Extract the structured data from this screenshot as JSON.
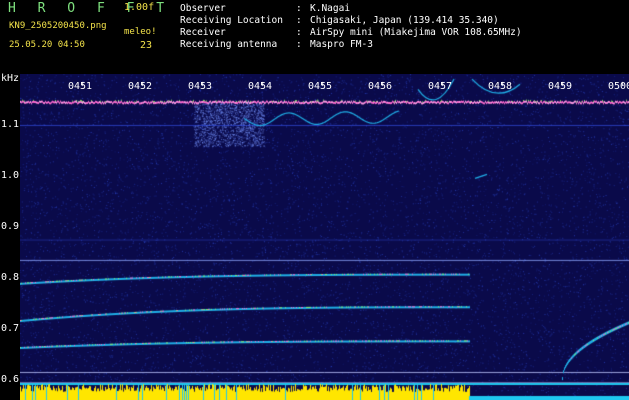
{
  "header": {
    "brand": "H R O F F T",
    "version": "1.00f",
    "filename": "KN9_2505200450.png",
    "datetime": "25.05.20 04:50",
    "counter_label": "meleo!",
    "counter_value": "23"
  },
  "info": [
    {
      "key": "Observer",
      "value": "K.Nagai"
    },
    {
      "key": "Receiving Location",
      "value": "Chigasaki, Japan (139.414 35.340)"
    },
    {
      "key": "Receiver",
      "value": "AirSpy mini (Miakejima VOR 108.65MHz)"
    },
    {
      "key": "Receiving antenna",
      "value": "Maspro FM-3"
    }
  ],
  "spectrogram": {
    "unit": "kHz",
    "time_ticks": [
      "0451",
      "0452",
      "0453",
      "0454",
      "0455",
      "0456",
      "0457",
      "0458",
      "0459",
      "0500"
    ],
    "freq_ticks": [
      "1.1",
      "1.0",
      "0.9",
      "0.8",
      "0.7",
      "0.6"
    ],
    "freq_range_khz": [
      0.56,
      1.2
    ],
    "colors": {
      "background": "#0a0a4a",
      "noise": "#2c46c8",
      "carrier": "#ff6ad0",
      "trace": "#1fb0e8",
      "trace_hot": "#8cf06a",
      "bottom_band": "#ffe600",
      "bottom_band_edge": "#1ec8f0"
    }
  }
}
